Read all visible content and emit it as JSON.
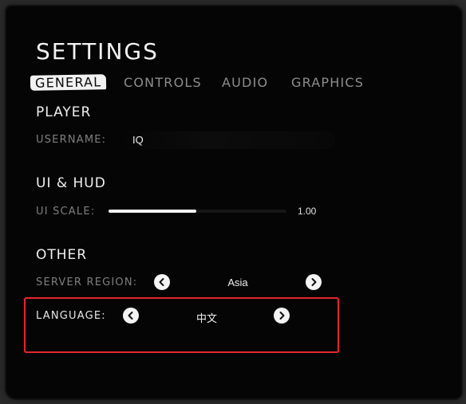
{
  "header": {
    "title": "SETTINGS"
  },
  "tabs": [
    {
      "id": "general",
      "label": "GENERAL",
      "active": true
    },
    {
      "id": "controls",
      "label": "CONTROLS",
      "active": false
    },
    {
      "id": "audio",
      "label": "AUDIO",
      "active": false
    },
    {
      "id": "graphics",
      "label": "GRAPHICS",
      "active": false
    }
  ],
  "player": {
    "section_title": "PLAYER",
    "username_label": "USERNAME:",
    "username_value": "IQ"
  },
  "ui_hud": {
    "section_title": "UI & HUD",
    "ui_scale_label": "UI SCALE:",
    "ui_scale_value": "1.00",
    "ui_scale_fill_fraction": 0.495
  },
  "other": {
    "section_title": "OTHER",
    "server_region_label": "SERVER REGION:",
    "server_region_value": "Asia",
    "language_label": "LANGUAGE:",
    "language_value": "中文"
  },
  "icons": {
    "prev": "chevron-left-icon",
    "next": "chevron-right-icon"
  },
  "colors": {
    "highlight": "#e3262e",
    "panel_bg": "#050505",
    "active_tab_bg": "#f2f2f2"
  }
}
